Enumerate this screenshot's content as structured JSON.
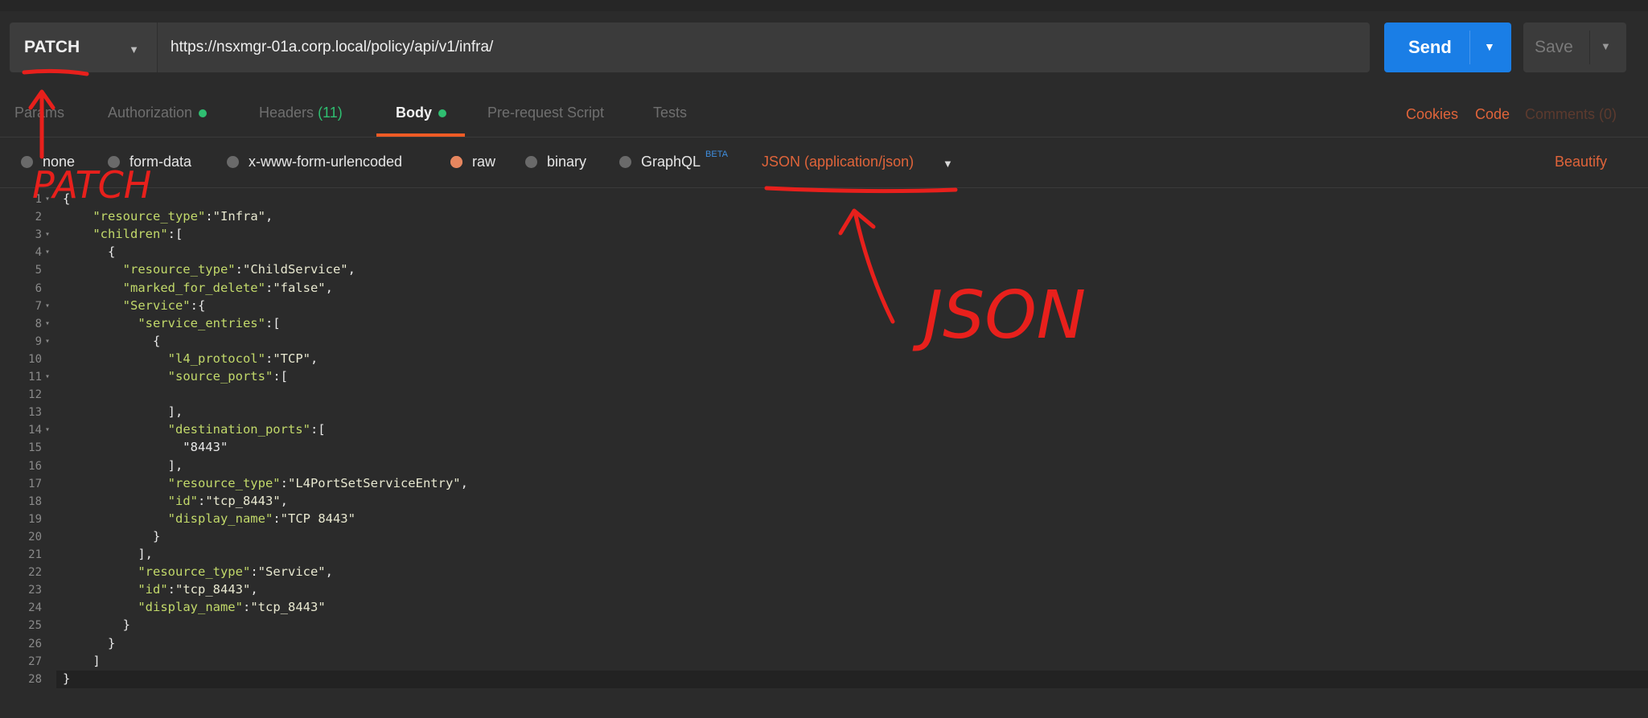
{
  "request": {
    "method": "PATCH",
    "url": "https://nsxmgr-01a.corp.local/policy/api/v1/infra/",
    "send_label": "Send",
    "save_label": "Save"
  },
  "tabs": {
    "params": "Params",
    "authorization": "Authorization",
    "headers": "Headers",
    "headers_count": "(11)",
    "body": "Body",
    "prerequest": "Pre-request Script",
    "tests": "Tests",
    "cookies": "Cookies",
    "code": "Code",
    "comments": "Comments (0)"
  },
  "body_options": {
    "none": "none",
    "form_data": "form-data",
    "urlencoded": "x-www-form-urlencoded",
    "raw": "raw",
    "binary": "binary",
    "graphql": "GraphQL",
    "graphql_badge": "BETA",
    "content_type": "JSON (application/json)",
    "beautify": "Beautify"
  },
  "editor": {
    "lines": [
      "{",
      "    \"resource_type\":\"Infra\",",
      "    \"children\":[",
      "      {",
      "        \"resource_type\":\"ChildService\",",
      "        \"marked_for_delete\":\"false\",",
      "        \"Service\":{",
      "          \"service_entries\":[",
      "            {",
      "              \"l4_protocol\":\"TCP\",",
      "              \"source_ports\":[",
      "",
      "              ],",
      "              \"destination_ports\":[",
      "                \"8443\"",
      "              ],",
      "              \"resource_type\":\"L4PortSetServiceEntry\",",
      "              \"id\":\"tcp_8443\",",
      "              \"display_name\":\"TCP 8443\"",
      "            }",
      "          ],",
      "          \"resource_type\":\"Service\",",
      "          \"id\":\"tcp_8443\",",
      "          \"display_name\":\"tcp_8443\"",
      "        }",
      "      }",
      "    ]",
      "}"
    ],
    "foldable_lines": [
      1,
      3,
      4,
      7,
      8,
      9,
      11,
      14
    ]
  },
  "annotations": {
    "patch": "PATCH",
    "json": "JSON"
  },
  "colors": {
    "accent_orange": "#e0643a",
    "send_blue": "#1a7ee6",
    "status_green": "#2fbf71",
    "annotation_red": "#e8201c"
  }
}
